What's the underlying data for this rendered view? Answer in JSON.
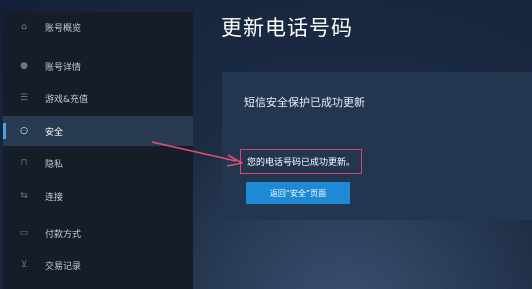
{
  "sidebar": {
    "items": [
      {
        "label": "账号概览",
        "icon": "home-icon"
      },
      {
        "label": "账号详情",
        "icon": "person-icon"
      },
      {
        "label": "游戏&充值",
        "icon": "list-icon"
      },
      {
        "label": "安全",
        "icon": "shield-icon",
        "active": true
      },
      {
        "label": "隐私",
        "icon": "lock-icon"
      },
      {
        "label": "连接",
        "icon": "link-icon"
      },
      {
        "label": "付款方式",
        "icon": "card-icon"
      },
      {
        "label": "交易记录",
        "icon": "cart-icon"
      }
    ]
  },
  "main": {
    "title": "更新电话号码",
    "card_heading": "短信安全保护已成功更新",
    "success_message": "您的电话号码已成功更新。",
    "return_button": "返回“安全”页面"
  },
  "colors": {
    "sidebar_bg": "#151d29",
    "active_bg": "#283b52",
    "accent": "#1e8ad6",
    "highlight_border": "#d6447c",
    "arrow": "#e0506c"
  }
}
